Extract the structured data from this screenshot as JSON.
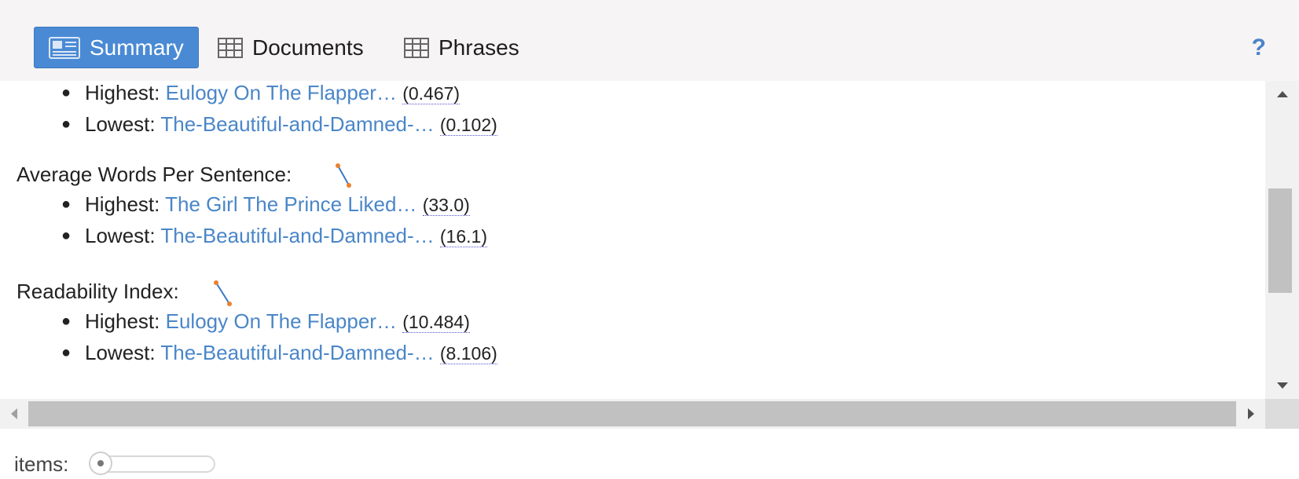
{
  "tabs": [
    {
      "label": "Summary",
      "active": true
    },
    {
      "label": "Documents",
      "active": false
    },
    {
      "label": "Phrases",
      "active": false
    }
  ],
  "help_label": "?",
  "sections": [
    {
      "heading": "",
      "highest": {
        "label": "Highest:",
        "doc": "Eulogy On The Flapper…",
        "value": "(0.467)"
      },
      "lowest": {
        "label": "Lowest:",
        "doc": "The-Beautiful-and-Damned-…",
        "value": "(0.102)"
      }
    },
    {
      "heading": "Average Words Per Sentence:",
      "highest": {
        "label": "Highest:",
        "doc": "The Girl The Prince Liked…",
        "value": "(33.0)"
      },
      "lowest": {
        "label": "Lowest:",
        "doc": "The-Beautiful-and-Damned-…",
        "value": "(16.1)"
      }
    },
    {
      "heading": "Readability Index:",
      "highest": {
        "label": "Highest:",
        "doc": "Eulogy On The Flapper…",
        "value": "(10.484)"
      },
      "lowest": {
        "label": "Lowest:",
        "doc": "The-Beautiful-and-Damned-…",
        "value": "(8.106)"
      }
    }
  ],
  "footer": {
    "items_label": "items:"
  },
  "colors": {
    "accent": "#4a8ad4",
    "link": "#4a86c8",
    "spark_line": "#3b78c9",
    "spark_dot": "#e8822e"
  }
}
